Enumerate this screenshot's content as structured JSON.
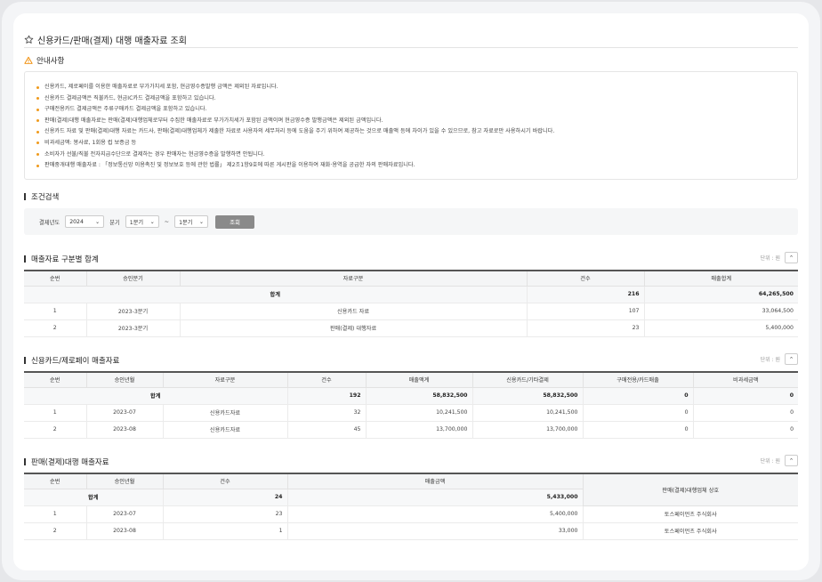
{
  "page": {
    "title": "신용카드/판매(결제) 대행 매출자료 조회",
    "star_icon": "star-icon"
  },
  "notice": {
    "heading": "안내사항",
    "items": [
      "신용카드, 제로페이를 이용한 매출자료로 부가가치세 포함, 현금영수증발행 금액은 제외된 자료입니다.",
      "신용카드 결제금액은 직불카드, 현금IC카드 결제금액을 포함하고 있습니다.",
      "구매전용카드 결제금액은 주류구매카드 결제금액을 포함하고 있습니다.",
      "판매(결제)대행 매출자료는 판매(결제)대행업체로부터 수집한 매출자료로 부가가치세가 포함된 금액이며 현금영수증 발행금액은 제외된 금액입니다.",
      "신용카드 자료 및 판매(결제)대행 자료는 카드사, 판매(결제)대행업체가 제출한 자료로 사용자의 세무처리 등에 도움을 주기 위하여 제공하는 것으로 매출액 등에 차이가 있을 수 있으므로, 참고 자료로만 사용하시기 바랍니다.",
      "비과세금액: 봉사료, 1회용 컵 보증금 등",
      "소비자가 선불/직불 전자지급수단으로 결제하는 경우 판매자는 현금영수증을 발행하면 안됩니다.",
      "판매중개대행 매출자료 : 「정보통신망 이용촉진 및 정보보호 등에 관한 법률」 제2조1항9호에 따른 게시판을 이용하여 재화·용역을 공급한 자의 판매자료입니다."
    ]
  },
  "search": {
    "heading": "조건검색",
    "year_label": "결제년도",
    "year_value": "2024",
    "quarter_label": "분기",
    "quarter_from": "1분기",
    "tilde": "~",
    "quarter_to": "1분기",
    "search_button": "조회"
  },
  "unit_label": "단위 : 원",
  "summary": {
    "heading": "매출자료 구분별 합계",
    "headers": [
      "순번",
      "승인분기",
      "자료구분",
      "건수",
      "매출합계"
    ],
    "total": {
      "label": "합계",
      "count": "216",
      "amount": "64,265,500"
    },
    "rows": [
      {
        "no": "1",
        "period": "2023-3분기",
        "type": "신용카드 자료",
        "count": "107",
        "amount": "33,064,500"
      },
      {
        "no": "2",
        "period": "2023-3분기",
        "type": "판매(결제) 대행자료",
        "count": "23",
        "amount": "5,400,000"
      }
    ]
  },
  "card": {
    "heading": "신용카드/제로페이 매출자료",
    "headers": [
      "순번",
      "승인년월",
      "자료구분",
      "건수",
      "매출액계",
      "신용카드/기타결제",
      "구매전용/카드매출",
      "비과세금액"
    ],
    "total": {
      "label": "합계",
      "count": "192",
      "sales": "58,832,500",
      "credit": "58,832,500",
      "purchase": "0",
      "taxfree": "0"
    },
    "rows": [
      {
        "no": "1",
        "month": "2023-07",
        "type": "신용카드자료",
        "count": "32",
        "sales": "10,241,500",
        "credit": "10,241,500",
        "purchase": "0",
        "taxfree": "0"
      },
      {
        "no": "2",
        "month": "2023-08",
        "type": "신용카드자료",
        "count": "45",
        "sales": "13,700,000",
        "credit": "13,700,000",
        "purchase": "0",
        "taxfree": "0"
      }
    ]
  },
  "agency": {
    "heading": "판매(결제)대행 매출자료",
    "headers": [
      "순번",
      "승인년월",
      "건수",
      "매출금액",
      "판매(결제)대행업체 상호"
    ],
    "total": {
      "label": "합계",
      "count": "24",
      "amount": "5,433,000"
    },
    "rows": [
      {
        "no": "1",
        "month": "2023-07",
        "count": "23",
        "amount": "5,400,000",
        "company": "토스페이먼츠 주식회사"
      },
      {
        "no": "2",
        "month": "2023-08",
        "count": "1",
        "amount": "33,000",
        "company": "토스페이먼츠 주식회사"
      }
    ]
  }
}
